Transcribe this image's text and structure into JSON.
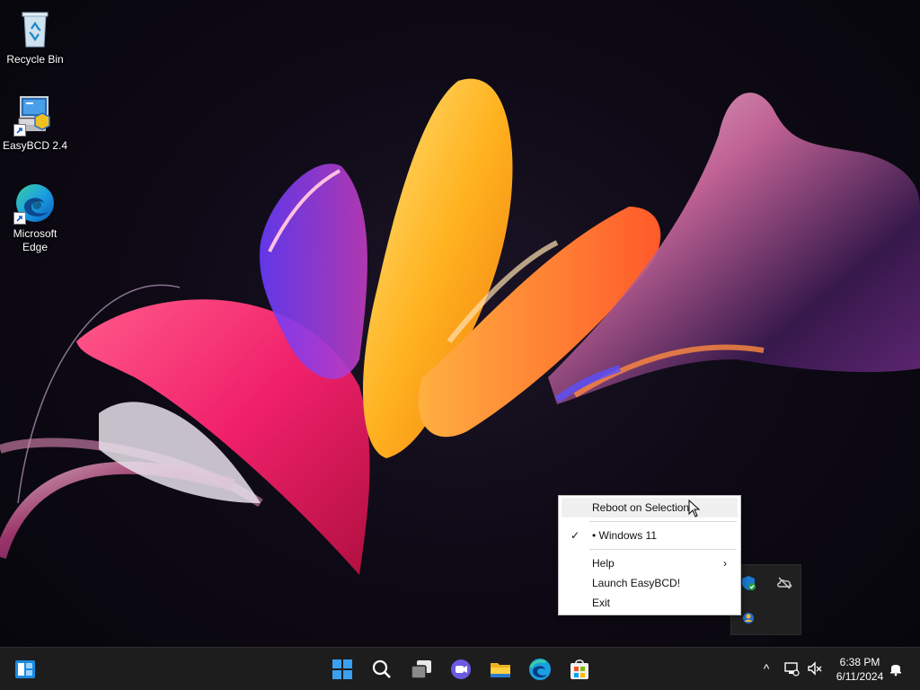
{
  "desktop": {
    "icons": [
      {
        "label": "Recycle Bin",
        "icon": "recycle-bin-icon"
      },
      {
        "label": "EasyBCD 2.4",
        "icon": "easybcd-icon"
      },
      {
        "label": "Microsoft Edge",
        "icon": "edge-icon"
      }
    ]
  },
  "context_menu": {
    "items": [
      {
        "label": "Reboot on Selection"
      },
      {
        "label": "• Windows 11",
        "check": "✓"
      },
      {
        "label": "Help",
        "arrow": "›"
      },
      {
        "label": "Launch EasyBCD!"
      },
      {
        "label": "Exit"
      }
    ]
  },
  "tray_flyout": {
    "icons": [
      "defender-shield-icon",
      "onedrive-offline-icon",
      "easybcd-tray-icon"
    ]
  },
  "taskbar": {
    "buttons": [
      "widgets-icon",
      "start-icon",
      "search-icon",
      "task-view-icon",
      "chat-icon",
      "file-explorer-icon",
      "edge-icon",
      "store-icon"
    ],
    "tray": {
      "chevron": "^",
      "time": "6:38 PM",
      "date": "6/11/2024"
    }
  },
  "colors": {
    "taskbar_bg": "#1d1d1d",
    "menu_bg": "#ffffff",
    "accent": "#0078d4"
  }
}
